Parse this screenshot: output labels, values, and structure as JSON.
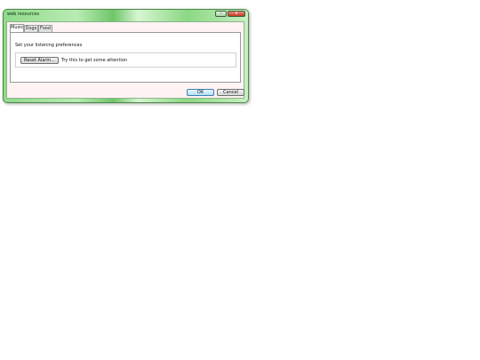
{
  "window": {
    "title": "web resources",
    "minimize_glyph": "–",
    "close_glyph": "x"
  },
  "tabs": [
    {
      "label": "Music",
      "active": true
    },
    {
      "label": "Dogs",
      "active": false
    },
    {
      "label": "Food",
      "active": false
    }
  ],
  "music_tab": {
    "preferences_text": "Set your listening preferences",
    "reset_button_label": "Reset Alarm...",
    "hint_text": "Try this to get some attention"
  },
  "dialog_buttons": {
    "ok_label": "OK",
    "cancel_label": "Cancel"
  },
  "colors": {
    "titlebar_accent": "#8fd98a",
    "close_button": "#c33a26",
    "client_background": "#fff3f3",
    "ok_button": "#b4def7"
  }
}
